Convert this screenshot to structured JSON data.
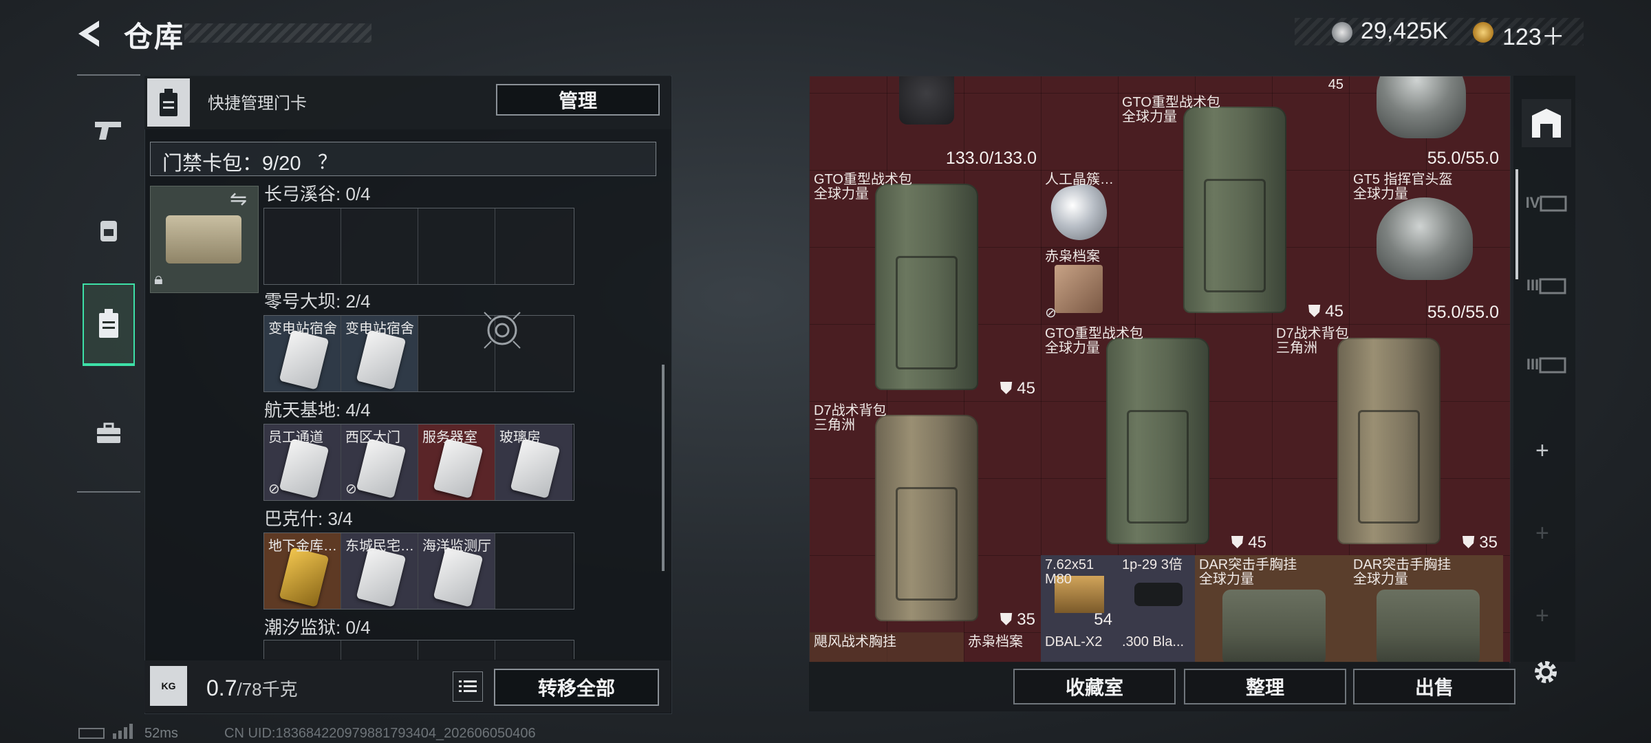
{
  "header": {
    "title": "仓库",
    "currency_coin": "29,425K",
    "currency_premium": "123＋"
  },
  "quick_manage": {
    "label": "快捷管理门卡",
    "manage_button": "管理"
  },
  "card_pack": {
    "label": "门禁卡包：9/20",
    "help": "？"
  },
  "zones": [
    {
      "title": "长弓溪谷: 0/4",
      "slots": []
    },
    {
      "title": "零号大坝: 2/4",
      "slots": [
        "变电站宿舍",
        "变电站宿舍"
      ]
    },
    {
      "title": "航天基地: 4/4",
      "slots": [
        "员工通道",
        "西区大门",
        "服务器室",
        "玻璃房"
      ]
    },
    {
      "title": "巴克什: 3/4",
      "slots": [
        "地下金库…",
        "东城民宅…",
        "海洋监测厅"
      ]
    },
    {
      "title": "潮汐监狱: 0/4",
      "slots": []
    }
  ],
  "weight": {
    "current": "0.7",
    "max": "/78千克",
    "icon_text": "KG"
  },
  "transfer_button": "转移全部",
  "status": {
    "ping": "52ms",
    "uid": "CN UID:18368422097988179340​4_202606050406"
  },
  "stash_items": {
    "top_left_durability": "133.0/133.0",
    "top_bag_count": "45",
    "top_bag_name": "GTO重型战术包\n全球力量",
    "top_helmet_durability": "55.0/55.0",
    "gto_left_name": "GTO重型战术包\n全球力量",
    "gto_left_count": "45",
    "crystal_name": "人工晶簇…",
    "dossier_name": "赤枭档案",
    "gt5_name": "GT5 指挥官头盔\n全球力量",
    "gt5_durability": "55.0/55.0",
    "gto_mid_name": "GTO重型战术包\n全球力量",
    "gto_mid_count": "45",
    "d7_right_name": "D7战术背包\n三角洲",
    "d7_right_count": "35",
    "d7_left_name": "D7战术背包\n三角洲",
    "d7_left_count": "35",
    "ammo_name": "7.62x51\nM80",
    "ammo_count": "54",
    "scope_name": "1p-29 3倍",
    "dar1_name": "DAR突击手胸挂\n全球力量",
    "dar2_name": "DAR突击手胸挂\n全球力量",
    "hurricane_name": "飓风战术胸挂",
    "dossier2_name": "赤枭档案",
    "dbal_name": "DBAL-X2",
    "ammo300_name": ".300 Bla..."
  },
  "bottom_buttons": {
    "collection": "收藏室",
    "sort": "整理",
    "sell": "出售"
  },
  "right_rail": {
    "tier4": "IV",
    "tier3a": "III",
    "tier3b": "III",
    "plus": "+"
  },
  "colors": {
    "accent_green": "#3de0a7",
    "stash_red": "#4a1e22"
  }
}
